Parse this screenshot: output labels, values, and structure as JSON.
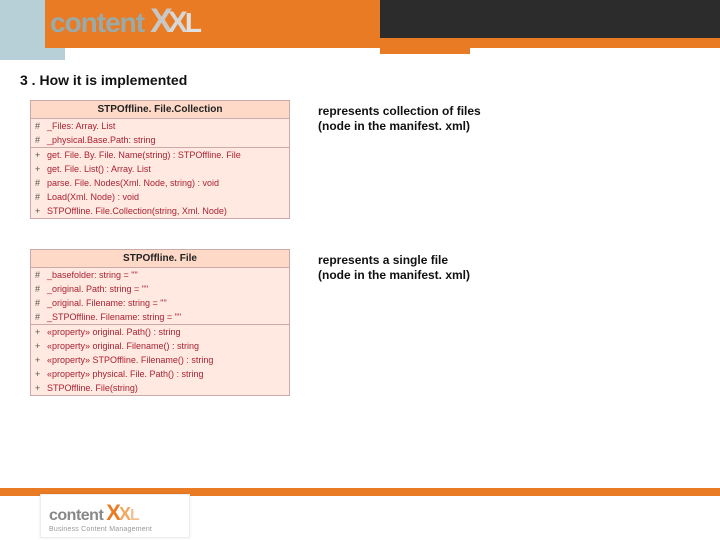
{
  "header": {
    "brand_text": "content",
    "brand_suffix_x1": "X",
    "brand_suffix_x2": "X",
    "brand_suffix_l": "L"
  },
  "slide": {
    "title": "3 . How it is implemented"
  },
  "uml": [
    {
      "class_name": "STPOffline. File.Collection",
      "description_lines": [
        "represents collection of files",
        "(node in the manifest. xml)"
      ],
      "attributes": [
        {
          "vis": "#",
          "sig": "_Files:  Array. List"
        },
        {
          "vis": "#",
          "sig": "_physical.Base.Path:  string"
        }
      ],
      "operations": [
        {
          "vis": "+",
          "sig": "get. File. By. File. Name(string) : STPOffline. File"
        },
        {
          "vis": "+",
          "sig": "get. File. List() : Array. List"
        },
        {
          "vis": "#",
          "sig": "parse. File. Nodes(Xml. Node, string) : void"
        },
        {
          "vis": "#",
          "sig": "Load(Xml. Node) : void"
        },
        {
          "vis": "+",
          "sig": "STPOffline. File.Collection(string, Xml. Node)"
        }
      ]
    },
    {
      "class_name": "STPOffline. File",
      "description_lines": [
        "represents a single file",
        "(node in the manifest. xml)"
      ],
      "attributes": [
        {
          "vis": "#",
          "sig": "_basefolder:  string = \"\""
        },
        {
          "vis": "#",
          "sig": "_original. Path:  string = \"\""
        },
        {
          "vis": "#",
          "sig": "_original. Filename:  string = \"\""
        },
        {
          "vis": "#",
          "sig": "_STPOffline. Filename:  string = \"\""
        }
      ],
      "operations": [
        {
          "vis": "+",
          "sig": "«property» original. Path() : string"
        },
        {
          "vis": "+",
          "sig": "«property» original. Filename() : string"
        },
        {
          "vis": "+",
          "sig": "«property» STPOffline. Filename() : string"
        },
        {
          "vis": "+",
          "sig": "«property» physical. File. Path() : string"
        },
        {
          "vis": "+",
          "sig": "STPOffline. File(string)"
        }
      ]
    }
  ],
  "footer": {
    "brand_text": "content",
    "brand_suffix_x1": "X",
    "brand_suffix_x2": "X",
    "brand_suffix_l": "L",
    "tagline": "Business Content Management"
  }
}
